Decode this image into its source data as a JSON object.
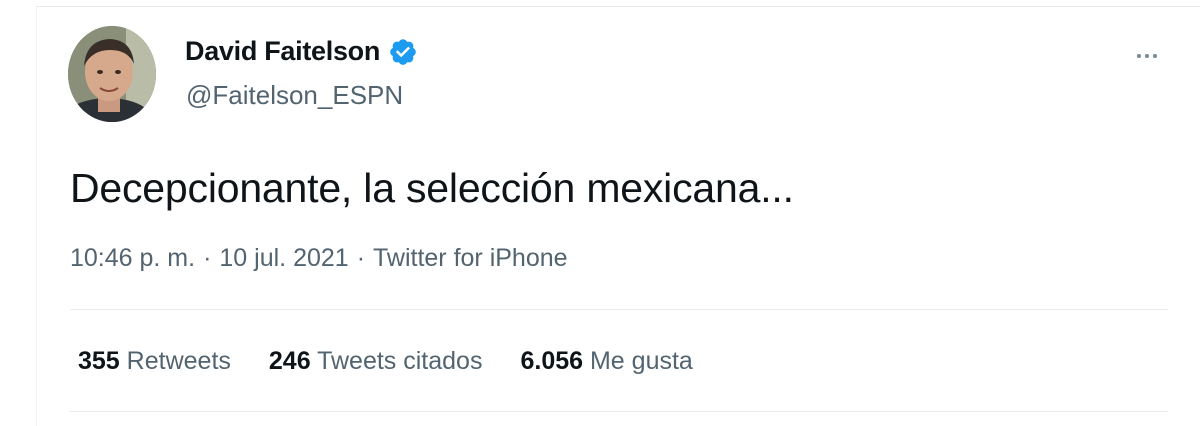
{
  "tweet": {
    "author": {
      "name": "David Faitelson",
      "handle": "@Faitelson_ESPN",
      "verified": true,
      "avatar_icon": "profile-photo"
    },
    "more_icon": "more-horizontal-icon",
    "text": "Decepcionante, la selección mexicana...",
    "meta": {
      "time": "10:46 p. m.",
      "date": "10 jul. 2021",
      "source": "Twitter for iPhone",
      "separator": "·"
    },
    "stats": [
      {
        "count": "355",
        "label": "Retweets"
      },
      {
        "count": "246",
        "label": "Tweets citados"
      },
      {
        "count": "6.056",
        "label": "Me gusta"
      }
    ]
  },
  "colors": {
    "verified": "#1d9bf0",
    "primary_text": "#0f1419",
    "secondary_text": "#536471",
    "divider": "#e6ecf0"
  }
}
